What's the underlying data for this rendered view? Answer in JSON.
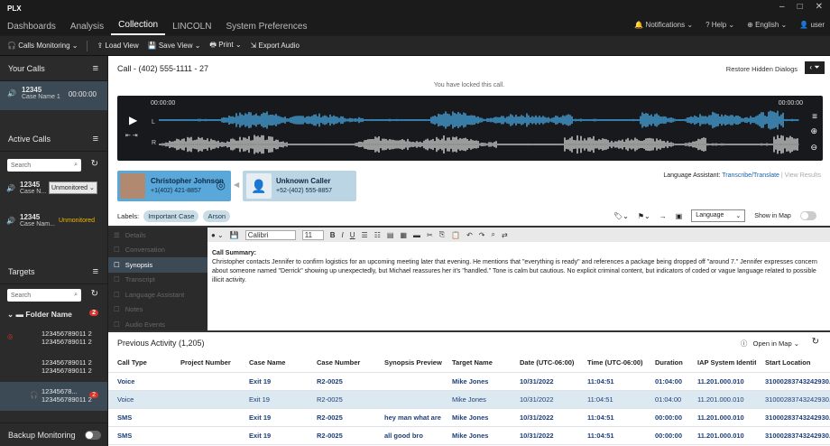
{
  "app": {
    "title": "PLX"
  },
  "window_controls": [
    "–",
    "□",
    "✕"
  ],
  "nav": {
    "tabs": [
      "Dashboards",
      "Analysis",
      "Collection",
      "LINCOLN",
      "System Preferences"
    ],
    "active": "Collection",
    "notifications": "Notifications",
    "help": "Help",
    "language": "English",
    "user": "user"
  },
  "toolbar": {
    "calls_monitoring": "Calls Monitoring",
    "load_view": "Load View",
    "save_view": "Save View",
    "print": "Print",
    "export_audio": "Export Audio"
  },
  "left": {
    "your_calls": {
      "title": "Your Calls",
      "item": {
        "number": "12345",
        "name": "Case Name 1",
        "time": "00:00:00"
      }
    },
    "active_calls": {
      "title": "Active Calls",
      "search_placeholder": "Search",
      "items": [
        {
          "number": "12345",
          "name": "Case N...",
          "status": "Unmonitored"
        },
        {
          "number": "12345",
          "name": "Case Nam...",
          "status": "Unmonitored"
        }
      ]
    },
    "targets": {
      "title": "Targets",
      "search_placeholder": "Search",
      "folder": "Folder Name",
      "folder_badge": "2",
      "items": [
        {
          "a": "123456789011 2",
          "b": "123456789011 2"
        },
        {
          "a": "123456789011 2",
          "b": "123456789011 2"
        },
        {
          "a": "12345678...",
          "b": "123456789011 2",
          "badge": "2"
        }
      ]
    },
    "backup": "Backup Monitoring"
  },
  "call": {
    "title": "Call - (402) 555-1111 - 27",
    "restore": "Restore Hidden Dialogs",
    "locked": "You have locked this call.",
    "time_start": "00:00:00",
    "time_end": "00:00:00",
    "ch_l": "L",
    "ch_r": "R"
  },
  "parties": {
    "a": {
      "name": "Christopher Johnson",
      "phone": "+1(402) 421-8857"
    },
    "b": {
      "name": "Unknown Caller",
      "phone": "+52-(402) 555-8857"
    }
  },
  "lang_assist": {
    "label": "Language Assistant:",
    "link": "Transcribe/Translate",
    "results": "View Results"
  },
  "labels": {
    "title": "Labels:",
    "items": [
      "Important Case",
      "Arson"
    ]
  },
  "tools": {
    "language": "Language",
    "show_in_map": "Show in Map"
  },
  "sidebar2": [
    "Details",
    "Conversation",
    "Synopsis",
    "Transcript",
    "Language Assistant",
    "Notes",
    "Audio Events"
  ],
  "editor": {
    "font": "Calibri",
    "size": "11",
    "heading": "Call Summary:",
    "body": "Christopher contacts Jennifer to confirm logistics for an upcoming meeting later that evening. He mentions that \"everything is ready\" and references a package being dropped off \"around 7.\" Jennifer expresses concern about someone named \"Derrick\" showing up unexpectedly, but Michael reassures her it's \"handled.\" Tone is calm but cautious. No explicit criminal content, but indicators of coded or vague language related to possible illicit activity."
  },
  "activity": {
    "title": "Previous Activity (1,205)",
    "open_map": "Open in Map",
    "columns": [
      "Call Type",
      "Project Number",
      "Case Name",
      "Case Number",
      "Synopsis Preview",
      "Target Name",
      "Date (UTC-06:00)",
      "Time (UTC-06:00)",
      "Duration",
      "IAP System Identity",
      "Start Location"
    ],
    "rows": [
      [
        "Voice",
        "",
        "Exit 19",
        "R2-0025",
        "",
        "Mike Jones",
        "10/31/2022",
        "11:04:51",
        "01:04:00",
        "11.201.000.010",
        "31000283743242930..."
      ],
      [
        "Voice",
        "",
        "Exit 19",
        "R2-0025",
        "",
        "Mike Jones",
        "10/31/2022",
        "11:04:51",
        "01:04:00",
        "11.201.000.010",
        "31000283743242930..."
      ],
      [
        "SMS",
        "",
        "Exit 19",
        "R2-0025",
        "hey man what are",
        "Mike Jones",
        "10/31/2022",
        "11:04:51",
        "00:00:00",
        "11.201.000.010",
        "31000283743242930..."
      ],
      [
        "SMS",
        "",
        "Exit 19",
        "R2-0025",
        "all good bro",
        "Mike Jones",
        "10/31/2022",
        "11:04:51",
        "00:00:00",
        "11.201.000.010",
        "31000283743242930..."
      ]
    ]
  }
}
